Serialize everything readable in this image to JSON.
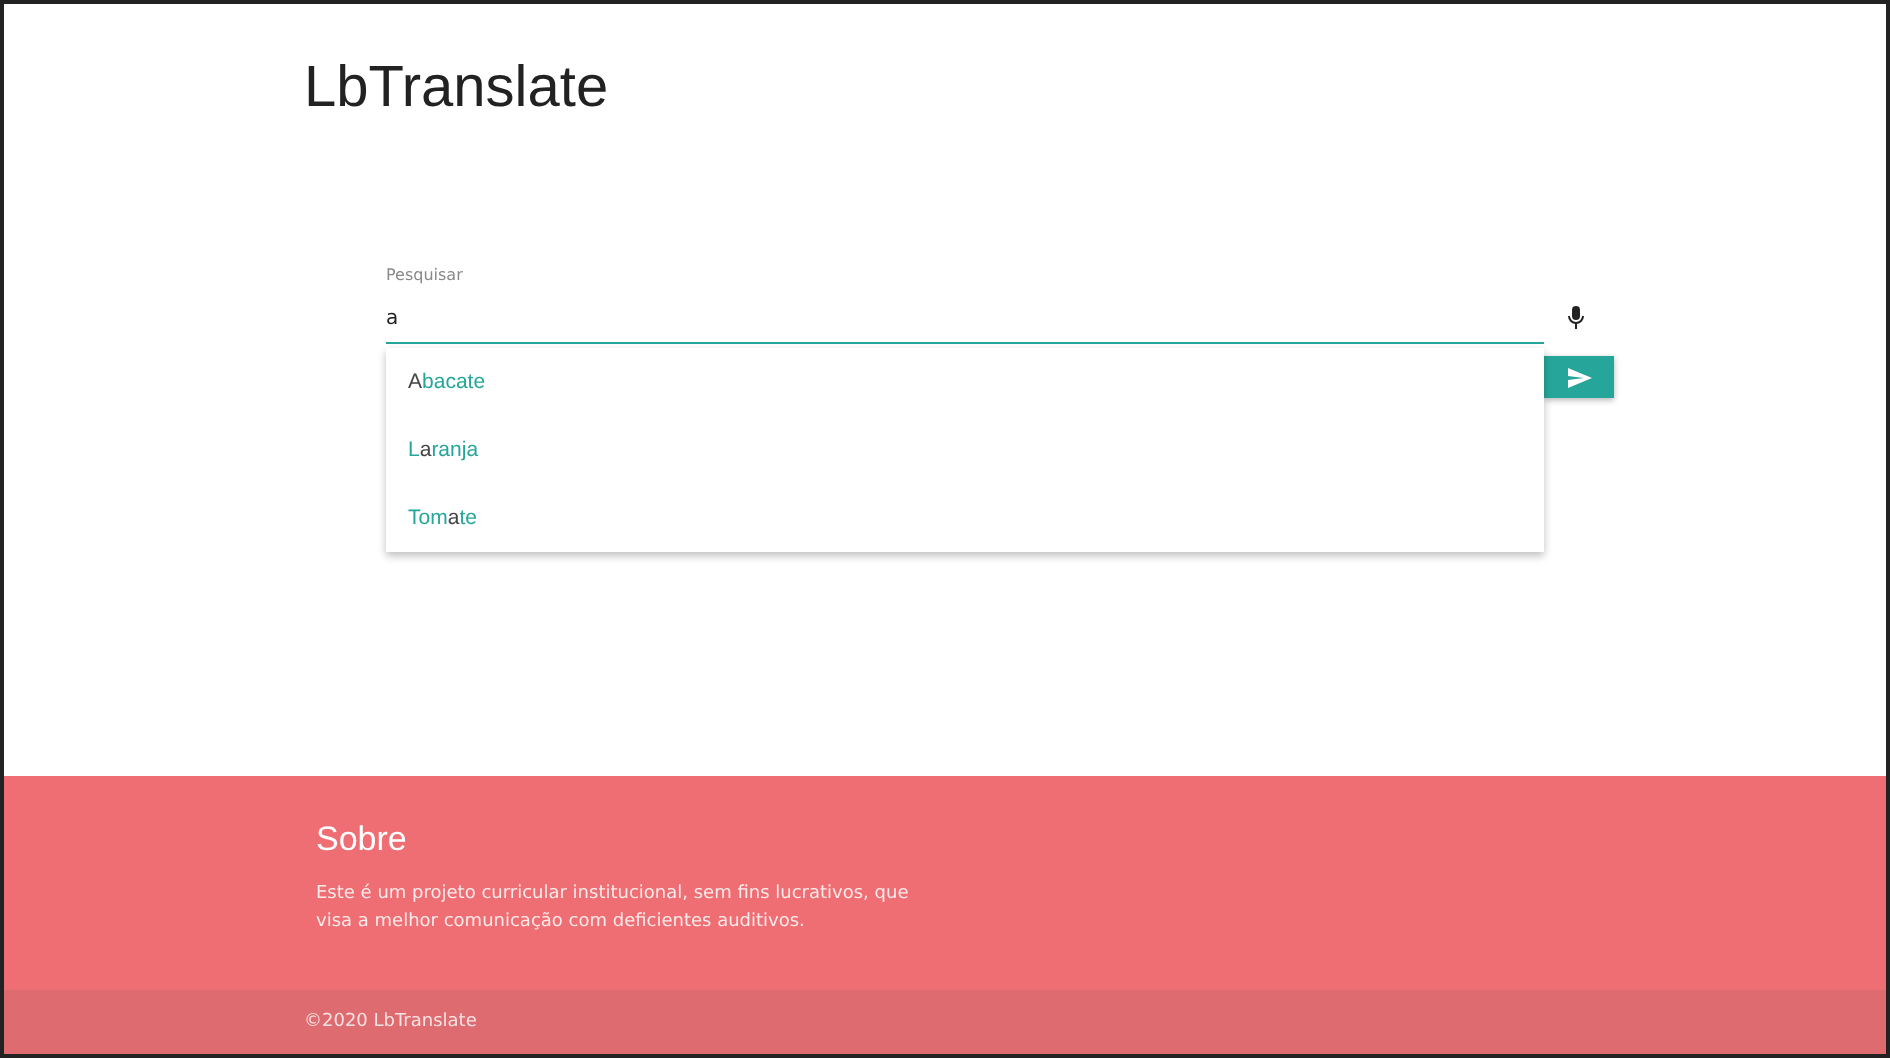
{
  "header": {
    "title": "LbTranslate"
  },
  "search": {
    "label": "Pesquisar",
    "value": "a"
  },
  "suggestions": [
    {
      "text": "**A**bacate"
    },
    {
      "text": "L**a**ranja"
    },
    {
      "text": "Tom**a**te"
    }
  ],
  "footer": {
    "heading": "Sobre",
    "text": "Este é um projeto curricular institucional, sem fins lucrativos, que visa a melhor comunicação com deficientes auditivos.",
    "copyright": "©2020 LbTranslate"
  }
}
